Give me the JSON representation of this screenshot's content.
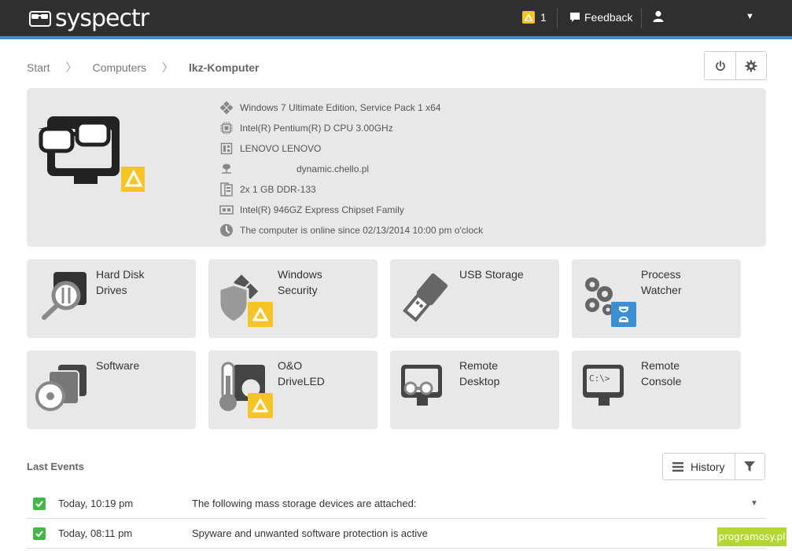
{
  "app": {
    "logo": "syspectr"
  },
  "topbar": {
    "alert_count": "1",
    "feedback_label": "Feedback",
    "user_menu_caret": "▼"
  },
  "breadcrumb": {
    "items": [
      "Start",
      "Computers"
    ],
    "sep": "〉",
    "current": "lkz-Komputer"
  },
  "computer": {
    "os": "Windows 7 Ultimate Edition, Service Pack 1 x64",
    "cpu": "Intel(R) Pentium(R) D CPU 3.00GHz",
    "board": "LENOVO LENOVO",
    "host": "dynamic.chello.pl",
    "ram": "2x 1 GB DDR-133",
    "chipset": "Intel(R) 946GZ Express Chipset Family",
    "status": "The computer is online since 02/13/2014 10:00 pm o'clock"
  },
  "tiles": [
    {
      "label": "Hard Disk\nDrives",
      "icon": "hard-disk-icon",
      "badge": null
    },
    {
      "label": "Windows\nSecurity",
      "icon": "windows-shield-icon",
      "badge": "warning"
    },
    {
      "label": "USB Storage",
      "icon": "usb-icon",
      "badge": null
    },
    {
      "label": "Process\nWatcher",
      "icon": "gears-icon",
      "badge": "hourglass"
    },
    {
      "label": "Software",
      "icon": "software-cd-icon",
      "badge": null
    },
    {
      "label": "O&O\nDriveLED",
      "icon": "thermometer-icon",
      "badge": "warning"
    },
    {
      "label": "Remote\nDesktop",
      "icon": "remote-desktop-icon",
      "badge": null
    },
    {
      "label": "Remote\nConsole",
      "icon": "console-icon",
      "badge": null
    }
  ],
  "events": {
    "title": "Last Events",
    "history_label": "History",
    "rows": [
      {
        "time": "Today, 10:19 pm",
        "text": "The following mass storage devices are attached:",
        "toggle": "▼"
      },
      {
        "time": "Today, 08:11 pm",
        "text": "Spyware and unwanted software protection is active"
      }
    ]
  },
  "watermark": "programosy.pl",
  "colors": {
    "topbar": "#2f2f2f",
    "accent": "#3d8fd1",
    "warning": "#f5c425",
    "success": "#45b649",
    "info": "#3d8fd1"
  }
}
